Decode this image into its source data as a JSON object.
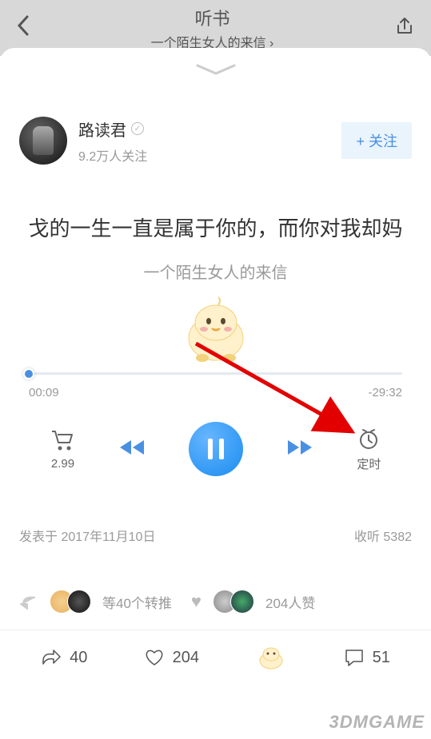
{
  "header": {
    "title": "听书",
    "subtitle": "一个陌生女人的来信"
  },
  "author": {
    "name": "路读君",
    "followers": "9.2万人关注",
    "follow_btn": "+ 关注"
  },
  "quote": "戈的一生一直是属于你的，而你对我却妈",
  "subtitle": "一个陌生女人的来信",
  "progress": {
    "elapsed": "00:09",
    "remaining": "-29:32"
  },
  "controls": {
    "price": "2.99",
    "timer": "定时"
  },
  "meta": {
    "published": "发表于 2017年11月10日",
    "plays": "收听 5382"
  },
  "social": {
    "reposts": "等40个转推",
    "likes": "204人赞"
  },
  "bottom": {
    "share": "40",
    "like": "204",
    "comment": "51"
  },
  "watermark": "3DMGAME"
}
